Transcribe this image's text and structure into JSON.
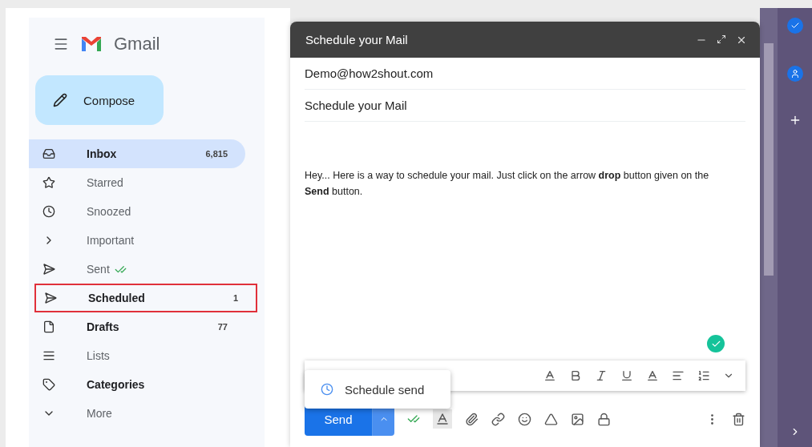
{
  "app": {
    "name": "Gmail",
    "compose_button": "Compose"
  },
  "sidebar": {
    "items": [
      {
        "kind": "inbox",
        "label": "Inbox",
        "count": "6,815",
        "selected": true,
        "bold": true,
        "outlined": false
      },
      {
        "kind": "star",
        "label": "Starred",
        "selected": false,
        "bold": false,
        "outlined": false
      },
      {
        "kind": "clock",
        "label": "Snoozed",
        "selected": false,
        "bold": false,
        "outlined": false
      },
      {
        "kind": "important",
        "label": "Important",
        "selected": false,
        "bold": false,
        "outlined": false
      },
      {
        "kind": "sent",
        "label": "Sent",
        "selected": false,
        "bold": false,
        "outlined": false
      },
      {
        "kind": "scheduled",
        "label": "Scheduled",
        "count": "1",
        "selected": false,
        "bold": true,
        "outlined": true
      },
      {
        "kind": "file",
        "label": "Drafts",
        "count": "77",
        "selected": false,
        "bold": true,
        "outlined": false
      },
      {
        "kind": "list",
        "label": "Lists",
        "selected": false,
        "bold": false,
        "outlined": false
      },
      {
        "kind": "label",
        "label": "Categories",
        "selected": false,
        "bold": true,
        "outlined": false
      },
      {
        "kind": "more",
        "label": "More",
        "selected": false,
        "bold": false,
        "outlined": false
      }
    ]
  },
  "compose": {
    "title": "Schedule your Mail",
    "to": "Demo@how2shout.com",
    "subject": "Schedule your Mail",
    "body": "Hey... Here is a way to schedule your mail. Just click on the arrow **drop** button given on the **Send** button.",
    "menu": {
      "items": [
        "Schedule send"
      ]
    },
    "send_button": "Send"
  }
}
